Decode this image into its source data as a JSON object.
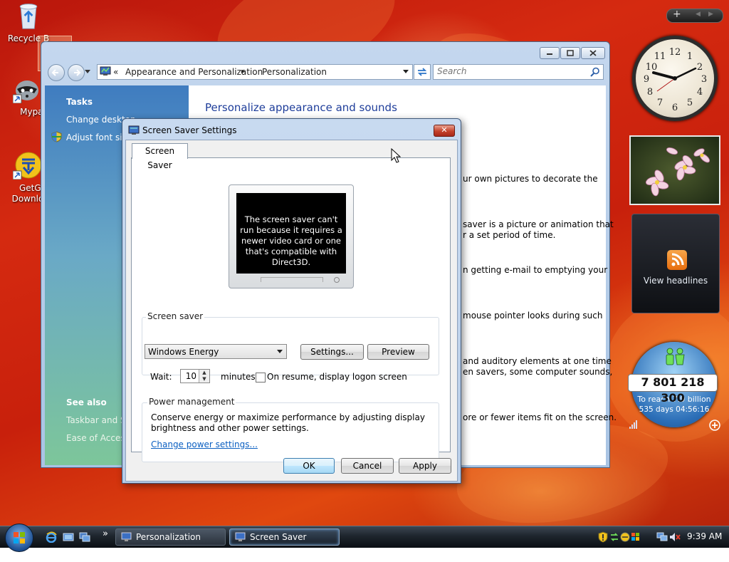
{
  "desktop": {
    "icons": [
      {
        "label": "Recycle B",
        "icon": "recycle-bin-icon"
      },
      {
        "label": "Mypal",
        "icon": "raccoon-app-icon"
      },
      {
        "label": "GetGo",
        "label2": "Downlo",
        "icon": "download-arrow-icon"
      }
    ]
  },
  "explorer": {
    "breadcrumb": {
      "sep": "«",
      "part1": "Appearance and Personalization",
      "arrow": "▸",
      "part2": "Personalization"
    },
    "search_placeholder": "Search",
    "tasks": {
      "heading": "Tasks",
      "items": [
        "Change desktop",
        "Adjust font size"
      ]
    },
    "see_also": {
      "heading": "See also",
      "items": [
        "Taskbar and St",
        "Ease of Access"
      ]
    },
    "title": "Personalize appearance and sounds",
    "fragments": [
      "ur own pictures to decorate the",
      "saver is a picture or animation that",
      "r a set period of time.",
      "n getting e-mail to emptying your",
      "mouse pointer looks during such",
      "and auditory elements at one time",
      "en savers, some computer sounds,",
      "ore or fewer items fit on the screen."
    ]
  },
  "dialog": {
    "title": "Screen Saver Settings",
    "tab": "Screen Saver",
    "preview_message": "The screen saver can't run because it requires a newer video card or one that's compatible with Direct3D.",
    "screensaver_group": "Screen saver",
    "selected_saver": "Windows Energy",
    "settings_button": "Settings...",
    "preview_button": "Preview",
    "wait_label": "Wait:",
    "wait_value": "10",
    "minutes_label": "minutes",
    "logon_label": "On resume, display logon screen",
    "logon_checked": false,
    "power_group": "Power management",
    "power_text1": "Conserve energy or maximize performance by adjusting display",
    "power_text2": "brightness and other power settings.",
    "power_link": "Change power settings...",
    "ok": "OK",
    "cancel": "Cancel",
    "apply": "Apply"
  },
  "sidebar": {
    "clock_numbers": [
      "12",
      "1",
      "2",
      "3",
      "4",
      "5",
      "6",
      "7",
      "8",
      "9",
      "10",
      "11"
    ],
    "feed_label": "View headlines",
    "population": "7 801 218 300",
    "population_line1": "To reach 7.9 billion",
    "population_line2": "535 days 04:56:16"
  },
  "taskbar": {
    "tasks": [
      "Personalization",
      "Screen Saver Settings"
    ],
    "overflow": "»",
    "time": "9:39 AM"
  },
  "colors": {
    "accent": "#1e3d9a",
    "link": "#0b5fc1",
    "desktop": "#c8200c"
  }
}
